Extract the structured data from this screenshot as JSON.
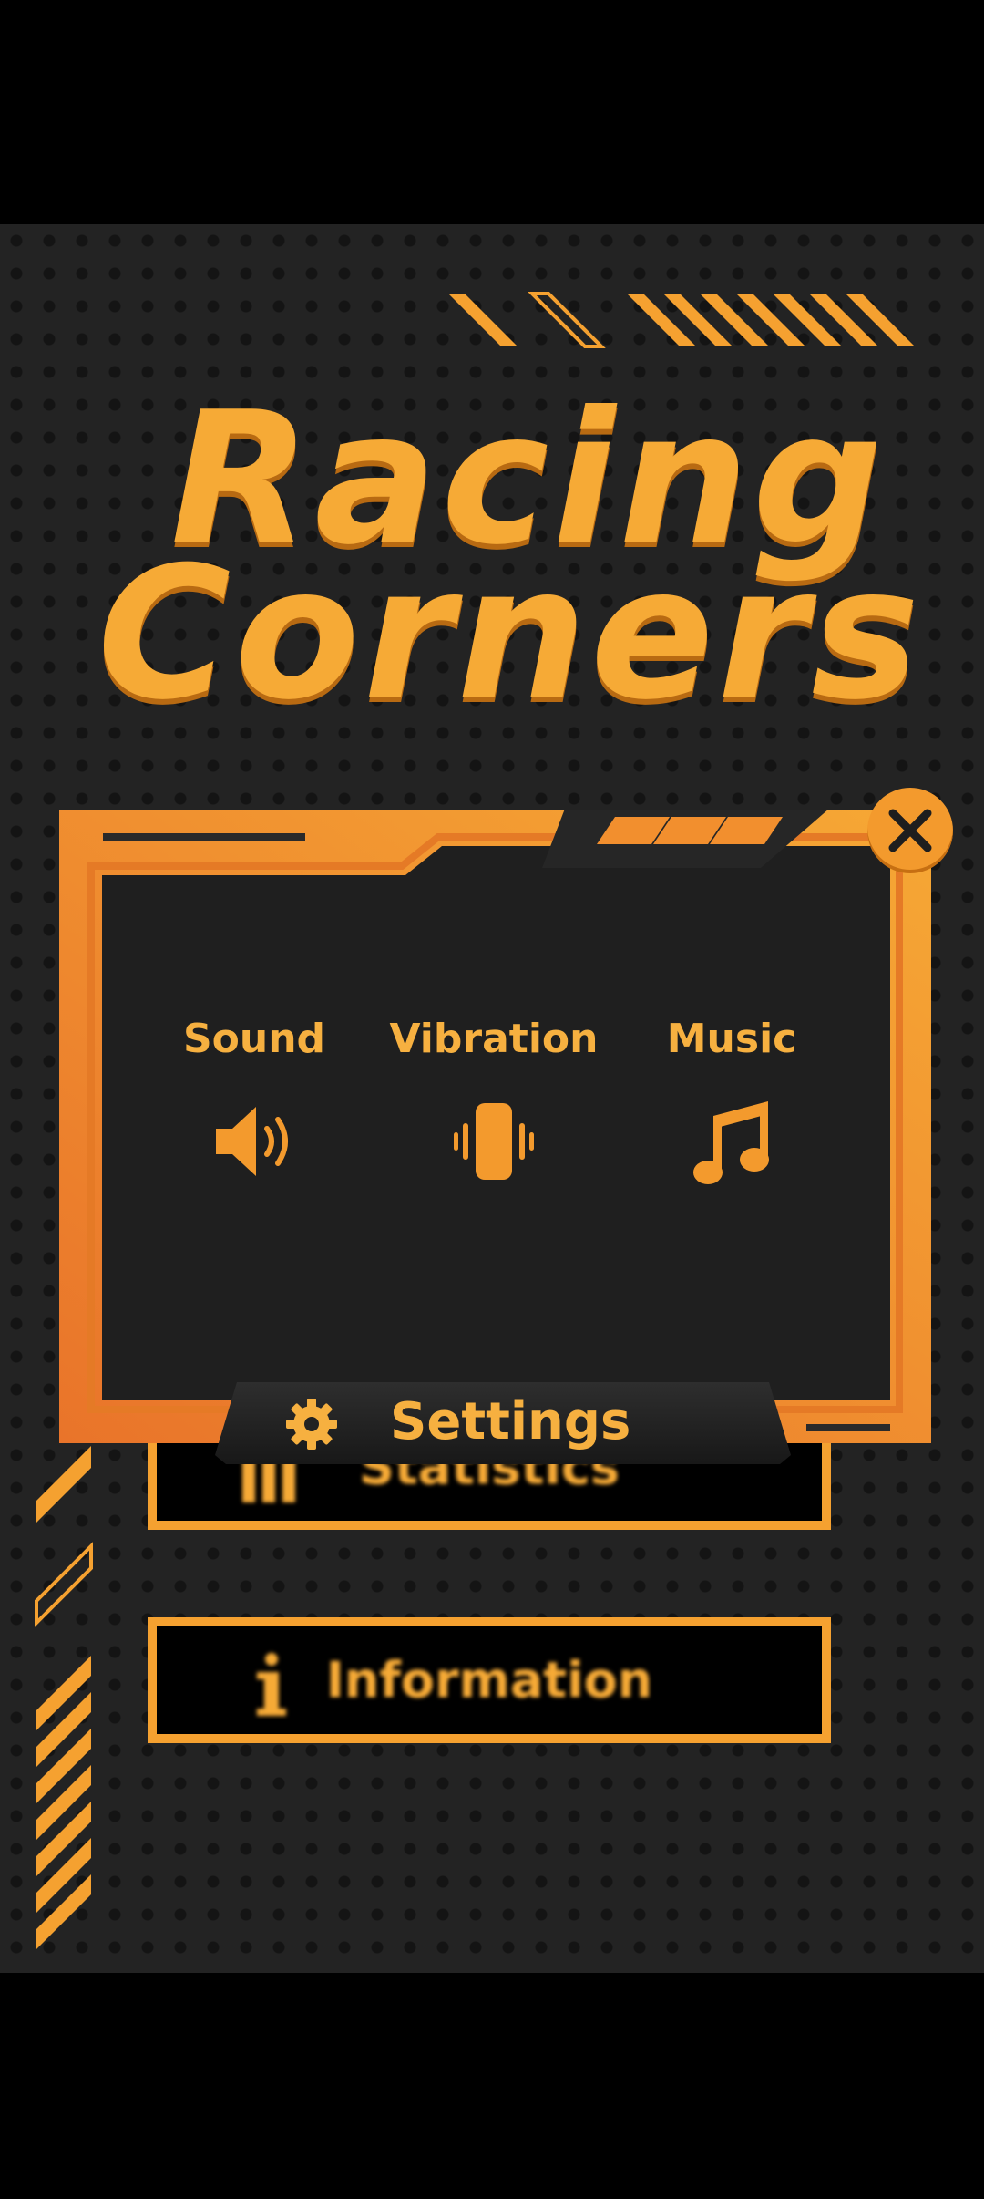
{
  "title": {
    "line1": "Racing",
    "line2": "Corners"
  },
  "menu": {
    "statistics_label": "Statistics",
    "information_label": "Information"
  },
  "settings": {
    "title": "Settings",
    "options": [
      {
        "label": "Sound",
        "icon": "speaker-icon"
      },
      {
        "label": "Vibration",
        "icon": "vibration-icon"
      },
      {
        "label": "Music",
        "icon": "music-note-icon"
      }
    ],
    "close_icon": "close-icon"
  },
  "colors": {
    "accent": "#f5a130",
    "accent_dark": "#e77a24",
    "panel_bg": "#1e1e1e",
    "background": "#232323"
  }
}
